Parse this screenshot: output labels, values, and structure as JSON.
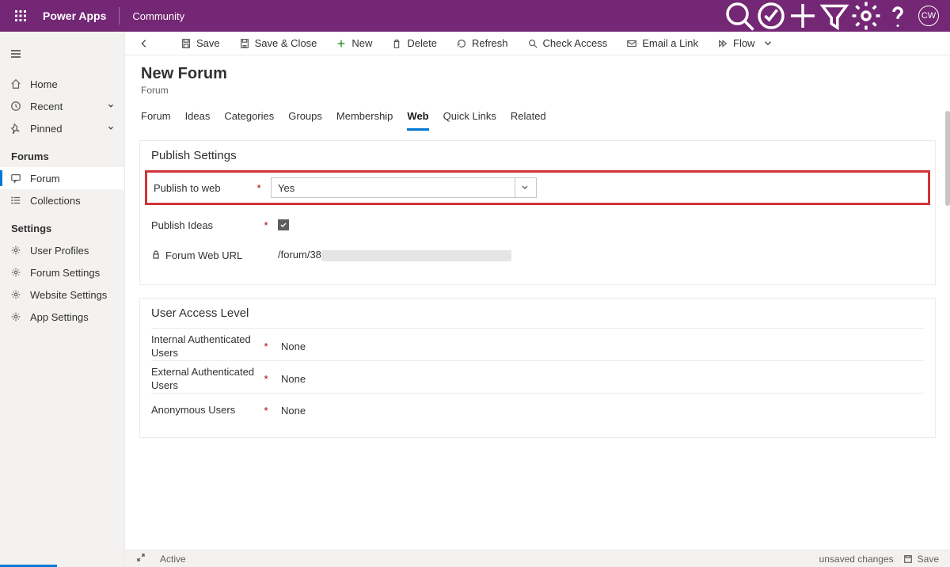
{
  "topbar": {
    "brand": "Power Apps",
    "env": "Community",
    "avatar": "CW"
  },
  "nav": {
    "primary": [
      {
        "label": "Home"
      },
      {
        "label": "Recent"
      },
      {
        "label": "Pinned"
      }
    ],
    "sections": [
      {
        "title": "Forums",
        "items": [
          {
            "label": "Forum",
            "active": true
          },
          {
            "label": "Collections"
          }
        ]
      },
      {
        "title": "Settings",
        "items": [
          {
            "label": "User Profiles"
          },
          {
            "label": "Forum Settings"
          },
          {
            "label": "Website Settings"
          },
          {
            "label": "App Settings"
          }
        ]
      }
    ]
  },
  "cmdbar": {
    "save": "Save",
    "saveClose": "Save & Close",
    "new": "New",
    "delete": "Delete",
    "refresh": "Refresh",
    "checkAccess": "Check Access",
    "emailLink": "Email a Link",
    "flow": "Flow"
  },
  "page": {
    "title": "New Forum",
    "subtitle": "Forum"
  },
  "tabs": [
    "Forum",
    "Ideas",
    "Categories",
    "Groups",
    "Membership",
    "Web",
    "Quick Links",
    "Related"
  ],
  "activeTab": "Web",
  "publishSettings": {
    "title": "Publish Settings",
    "publishToWeb": {
      "label": "Publish to web",
      "value": "Yes"
    },
    "publishIdeas": {
      "label": "Publish Ideas",
      "checked": true
    },
    "webUrl": {
      "label": "Forum Web URL",
      "prefix": "/forum/38"
    }
  },
  "userAccess": {
    "title": "User Access Level",
    "rows": [
      {
        "label": "Internal Authenticated Users",
        "value": "None"
      },
      {
        "label": "External Authenticated Users",
        "value": "None"
      },
      {
        "label": "Anonymous Users",
        "value": "None"
      }
    ]
  },
  "status": {
    "state": "Active",
    "unsaved": "unsaved changes",
    "save": "Save"
  }
}
